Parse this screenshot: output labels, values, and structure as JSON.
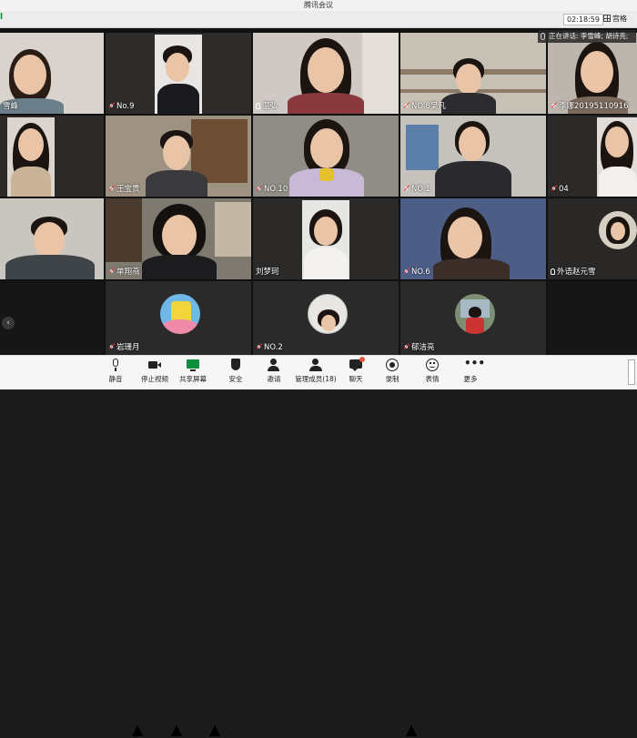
{
  "window": {
    "title": "腾讯会议"
  },
  "topbar": {
    "timer": "02:18:59",
    "layout_label": "宫格",
    "left_mark": "l"
  },
  "speaker_bar": {
    "text": "正在讲话: 李雪峰; 胡诗亮;"
  },
  "tiles": [
    {
      "label": "雪峰",
      "icon": "none"
    },
    {
      "label": "No.9",
      "icon": "muted"
    },
    {
      "label": "温弘",
      "icon": "mic"
    },
    {
      "label": "NO.8吴凡",
      "icon": "muted"
    },
    {
      "label": "李娜20195110916",
      "icon": "muted"
    },
    {
      "label": "",
      "icon": "none"
    },
    {
      "label": "王宝贵",
      "icon": "muted"
    },
    {
      "label": "NO.10",
      "icon": "muted"
    },
    {
      "label": "NO.1",
      "icon": "muted"
    },
    {
      "label": "04",
      "icon": "muted"
    },
    {
      "label": "",
      "icon": "none"
    },
    {
      "label": "单翔燕",
      "icon": "muted"
    },
    {
      "label": "刘梦珂",
      "icon": "none"
    },
    {
      "label": "NO.6",
      "icon": "muted"
    },
    {
      "label": "外语赵元雪",
      "icon": "mic"
    },
    {
      "label": "",
      "icon": "none"
    },
    {
      "label": "岩珊月",
      "icon": "muted"
    },
    {
      "label": "NO.2",
      "icon": "muted"
    },
    {
      "label": "郁洁亮",
      "icon": "muted"
    },
    {
      "label": "",
      "icon": "none"
    }
  ],
  "toolbar": {
    "mute": "静音",
    "stop_video": "停止视频",
    "share_screen": "共享屏幕",
    "security": "安全",
    "invite": "邀请",
    "manage_members": "管理成员(18)",
    "chat": "聊天",
    "record": "录制",
    "reactions": "表情",
    "more": "更多"
  },
  "colors": {
    "accent": "#1e7ce6",
    "badge": "#e55533",
    "active_green": "#0a8f3a"
  }
}
